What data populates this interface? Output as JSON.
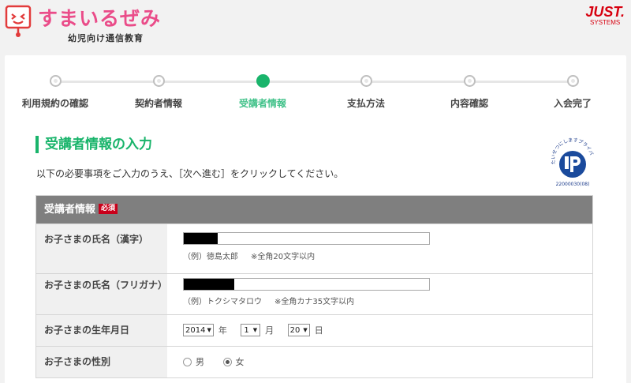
{
  "header": {
    "logo_text": "すまいるぜみ",
    "logo_subtitle": "幼児向け通信教育",
    "brand_main": "JUST.",
    "brand_sub": "SYSTEMS",
    "brand_color": "#d7000f",
    "logo_color": "#e9468a"
  },
  "stepper": {
    "steps": [
      {
        "label": "利用規約の確認",
        "state": "done"
      },
      {
        "label": "契約者情報",
        "state": "done"
      },
      {
        "label": "受講者情報",
        "state": "current"
      },
      {
        "label": "支払方法",
        "state": "todo"
      },
      {
        "label": "内容確認",
        "state": "todo"
      },
      {
        "label": "入会完了",
        "state": "todo"
      }
    ],
    "active_color": "#19b46b"
  },
  "page": {
    "title": "受講者情報の入力",
    "description": "以下の必要事項をご入力のうえ、［次へ進む］をクリックしてください。",
    "privacy_mark_text": "たいせつにしますプライバシー",
    "privacy_mark_number": "22000030(08)"
  },
  "form": {
    "section_title": "受講者情報",
    "required_badge": "必須",
    "name_kanji": {
      "label": "お子さまの氏名（漢字）",
      "value": "",
      "hint_example": "（例）徳島太郎",
      "hint_rule": "※全角20文字以内"
    },
    "name_kana": {
      "label": "お子さまの氏名（フリガナ）",
      "value": "",
      "hint_example": "（例）トクシマタロウ",
      "hint_rule": "※全角カナ35文字以内"
    },
    "birthdate": {
      "label": "お子さまの生年月日",
      "year": "2014",
      "year_unit": "年",
      "month": "1",
      "month_unit": "月",
      "day": "20",
      "day_unit": "日"
    },
    "gender": {
      "label": "お子さまの性別",
      "options": [
        {
          "label": "男",
          "checked": false
        },
        {
          "label": "女",
          "checked": true
        }
      ]
    }
  }
}
